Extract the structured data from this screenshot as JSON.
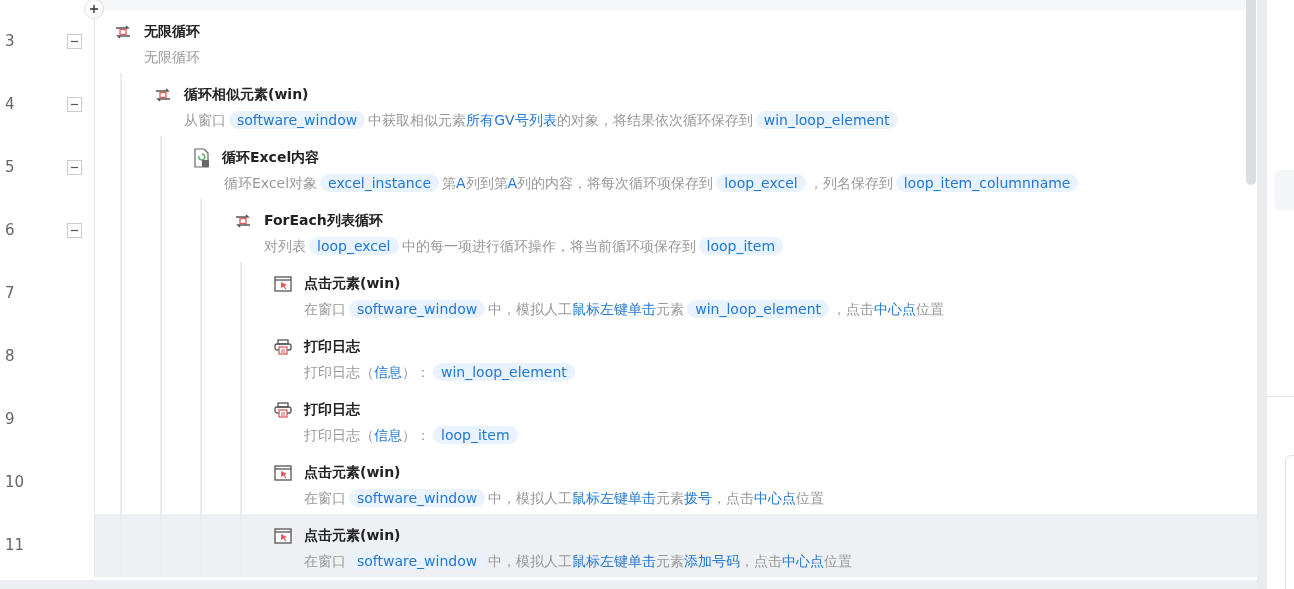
{
  "steps": [
    {
      "number": "3",
      "kind": "loop",
      "title": "无限循环",
      "expanded": true,
      "selected": false,
      "description": [
        {
          "kind": "text",
          "text": "无限循环"
        }
      ],
      "children": [
        {
          "number": "4",
          "kind": "loop",
          "title": "循环相似元素(win)",
          "expanded": true,
          "selected": false,
          "description": [
            {
              "kind": "text",
              "text": "从窗口"
            },
            {
              "kind": "chip",
              "text": "software_window"
            },
            {
              "kind": "text",
              "text": "中获取相似元素"
            },
            {
              "kind": "em",
              "text": "所有GV号列表"
            },
            {
              "kind": "text",
              "text": "的对象，将结果依次循环保存到"
            },
            {
              "kind": "chip",
              "text": "win_loop_element"
            }
          ],
          "children": [
            {
              "number": "5",
              "kind": "excel",
              "title": "循环Excel内容",
              "expanded": true,
              "selected": false,
              "description": [
                {
                  "kind": "text",
                  "text": "循环Excel对象"
                },
                {
                  "kind": "chip",
                  "text": "excel_instance"
                },
                {
                  "kind": "text",
                  "text": "第"
                },
                {
                  "kind": "em",
                  "text": "A"
                },
                {
                  "kind": "text",
                  "text": "列到第"
                },
                {
                  "kind": "em",
                  "text": "A"
                },
                {
                  "kind": "text",
                  "text": "列的内容，将每次循环项保存到"
                },
                {
                  "kind": "chip",
                  "text": "loop_excel"
                },
                {
                  "kind": "text",
                  "text": "，列名保存到"
                },
                {
                  "kind": "chip",
                  "text": "loop_item_columnname"
                }
              ],
              "children": [
                {
                  "number": "6",
                  "kind": "loop",
                  "title": "ForEach列表循环",
                  "expanded": true,
                  "selected": false,
                  "description": [
                    {
                      "kind": "text",
                      "text": "对列表"
                    },
                    {
                      "kind": "chip",
                      "text": "loop_excel"
                    },
                    {
                      "kind": "text",
                      "text": "中的每一项进行循环操作，将当前循环项保存到"
                    },
                    {
                      "kind": "chip",
                      "text": "loop_item"
                    }
                  ],
                  "children": [
                    {
                      "number": "7",
                      "kind": "click",
                      "title": "点击元素(win)",
                      "selected": false,
                      "description": [
                        {
                          "kind": "text",
                          "text": "在窗口"
                        },
                        {
                          "kind": "chip",
                          "text": "software_window"
                        },
                        {
                          "kind": "text",
                          "text": "中，模拟人工"
                        },
                        {
                          "kind": "em",
                          "text": "鼠标左键单击"
                        },
                        {
                          "kind": "text",
                          "text": "元素"
                        },
                        {
                          "kind": "chip",
                          "text": "win_loop_element"
                        },
                        {
                          "kind": "text",
                          "text": "，点击"
                        },
                        {
                          "kind": "em",
                          "text": "中心点"
                        },
                        {
                          "kind": "text",
                          "text": "位置"
                        }
                      ]
                    },
                    {
                      "number": "8",
                      "kind": "print",
                      "title": "打印日志",
                      "selected": false,
                      "description": [
                        {
                          "kind": "text",
                          "text": "打印日志（"
                        },
                        {
                          "kind": "em",
                          "text": "信息"
                        },
                        {
                          "kind": "text",
                          "text": "）："
                        },
                        {
                          "kind": "chip",
                          "text": "win_loop_element"
                        }
                      ]
                    },
                    {
                      "number": "9",
                      "kind": "print",
                      "title": "打印日志",
                      "selected": false,
                      "description": [
                        {
                          "kind": "text",
                          "text": "打印日志（"
                        },
                        {
                          "kind": "em",
                          "text": "信息"
                        },
                        {
                          "kind": "text",
                          "text": "）："
                        },
                        {
                          "kind": "chip",
                          "text": "loop_item"
                        }
                      ]
                    },
                    {
                      "number": "10",
                      "kind": "click",
                      "title": "点击元素(win)",
                      "selected": false,
                      "description": [
                        {
                          "kind": "text",
                          "text": "在窗口"
                        },
                        {
                          "kind": "chip",
                          "text": "software_window"
                        },
                        {
                          "kind": "text",
                          "text": "中，模拟人工"
                        },
                        {
                          "kind": "em",
                          "text": "鼠标左键单击"
                        },
                        {
                          "kind": "text",
                          "text": "元素"
                        },
                        {
                          "kind": "em",
                          "text": "拨号"
                        },
                        {
                          "kind": "text",
                          "text": "，点击"
                        },
                        {
                          "kind": "em",
                          "text": "中心点"
                        },
                        {
                          "kind": "text",
                          "text": "位置"
                        }
                      ]
                    },
                    {
                      "number": "11",
                      "kind": "click",
                      "title": "点击元素(win)",
                      "selected": true,
                      "description": [
                        {
                          "kind": "text",
                          "text": "在窗口"
                        },
                        {
                          "kind": "chip",
                          "text": "software_window"
                        },
                        {
                          "kind": "text",
                          "text": "中，模拟人工"
                        },
                        {
                          "kind": "em",
                          "text": "鼠标左键单击"
                        },
                        {
                          "kind": "text",
                          "text": "元素"
                        },
                        {
                          "kind": "em",
                          "text": "添加号码"
                        },
                        {
                          "kind": "text",
                          "text": "，点击"
                        },
                        {
                          "kind": "em",
                          "text": "中心点"
                        },
                        {
                          "kind": "text",
                          "text": "位置"
                        }
                      ]
                    }
                  ]
                }
              ]
            }
          ]
        }
      ]
    }
  ]
}
